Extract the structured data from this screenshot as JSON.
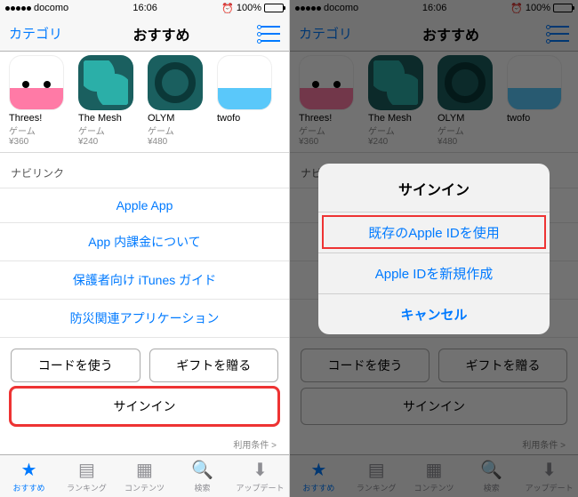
{
  "status": {
    "carrier": "docomo",
    "time": "16:06",
    "battery": "100%"
  },
  "nav": {
    "left": "カテゴリ",
    "title": "おすすめ"
  },
  "apps": [
    {
      "name": "Threes!",
      "category": "ゲーム",
      "price": "¥360",
      "iconClass": "icon-threes"
    },
    {
      "name": "The Mesh",
      "category": "ゲーム",
      "price": "¥240",
      "iconClass": "icon-mesh"
    },
    {
      "name": "OLYM",
      "category": "ゲーム",
      "price": "¥480",
      "iconClass": "icon-olym"
    },
    {
      "name": "twofo",
      "category": "",
      "price": "",
      "iconClass": "icon-twofc"
    }
  ],
  "section": {
    "navlink": "ナビリンク"
  },
  "links": {
    "appleApp": "Apple App",
    "iap": "App 内課金について",
    "itunesGuide": "保護者向け iTunes ガイド",
    "disaster": "防災関連アプリケーション"
  },
  "buttons": {
    "code": "コードを使う",
    "gift": "ギフトを贈る",
    "signin": "サインイン"
  },
  "terms": "利用条件 >",
  "tabs": {
    "featured": "おすすめ",
    "ranking": "ランキング",
    "contents": "コンテンツ",
    "search": "検索",
    "update": "アップデート"
  },
  "alert": {
    "title": "サインイン",
    "existing": "既存のApple IDを使用",
    "create": "Apple IDを新規作成",
    "cancel": "キャンセル"
  }
}
